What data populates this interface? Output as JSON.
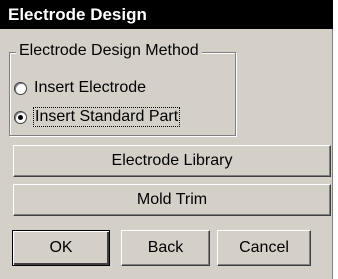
{
  "dialog": {
    "title": "Electrode Design",
    "group": {
      "legend": "Electrode Design Method",
      "options": [
        {
          "label": "Insert Electrode",
          "selected": false
        },
        {
          "label": "Insert Standard Part",
          "selected": true
        }
      ]
    },
    "buttons": {
      "electrode_library": "Electrode Library",
      "mold_trim": "Mold Trim",
      "ok": "OK",
      "back": "Back",
      "cancel": "Cancel"
    }
  }
}
